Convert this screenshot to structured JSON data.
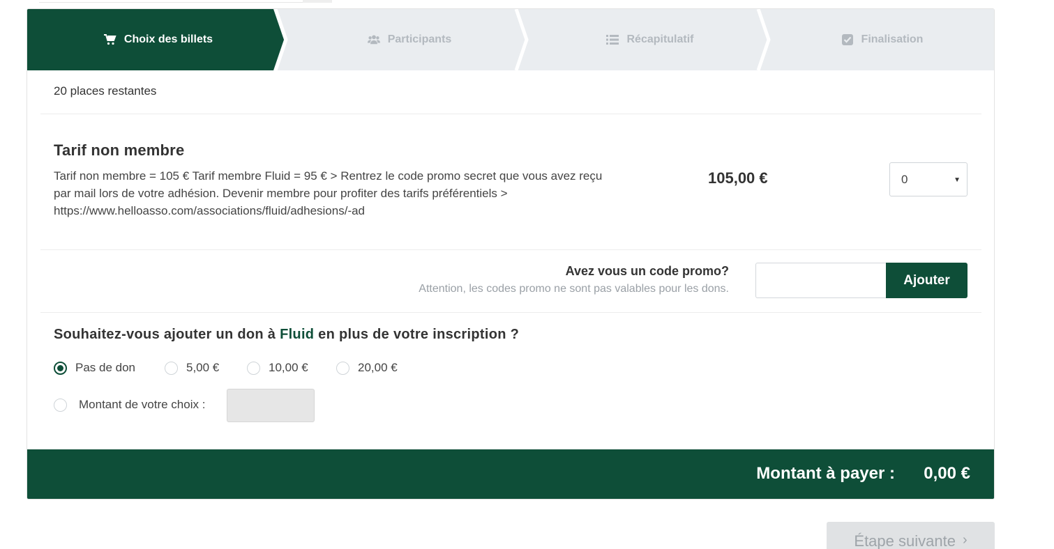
{
  "steps": [
    {
      "label": "Choix des billets",
      "icon": "cart-icon",
      "active": true
    },
    {
      "label": "Participants",
      "icon": "users-icon",
      "active": false
    },
    {
      "label": "Récapitulatif",
      "icon": "list-icon",
      "active": false
    },
    {
      "label": "Finalisation",
      "icon": "checkbox-icon",
      "active": false
    }
  ],
  "places_remaining": "20 places restantes",
  "tarif": {
    "title": "Tarif non membre",
    "description": "Tarif non membre = 105 € Tarif membre Fluid = 95 € > Rentrez le code promo secret que vous avez reçu par mail lors de votre adhésion. Devenir membre pour profiter des tarifs préférentiels > https://www.helloasso.com/associations/fluid/adhesions/-ad",
    "price": "105,00 €",
    "quantity": "0"
  },
  "promo": {
    "question": "Avez vous un code promo?",
    "note": "Attention, les codes promo ne sont pas valables pour les dons.",
    "input_value": "",
    "button_label": "Ajouter"
  },
  "donation": {
    "question_prefix": "Souhaitez-vous ajouter un don à ",
    "org_name": "Fluid",
    "question_suffix": " en plus de votre inscription ?",
    "options": [
      "Pas de don",
      "5,00 €",
      "10,00 €",
      "20,00 €"
    ],
    "selected": "Pas de don",
    "custom_label": "Montant de votre choix :",
    "custom_value": ""
  },
  "total": {
    "label": "Montant à payer :",
    "value": "0,00 €"
  },
  "next_button": {
    "label": "Étape suivante",
    "arrow": "›"
  },
  "colors": {
    "brand": "#0e4e38",
    "steps_inactive_bg": "#eaedf0",
    "steps_inactive_text": "#b3b9bf"
  }
}
